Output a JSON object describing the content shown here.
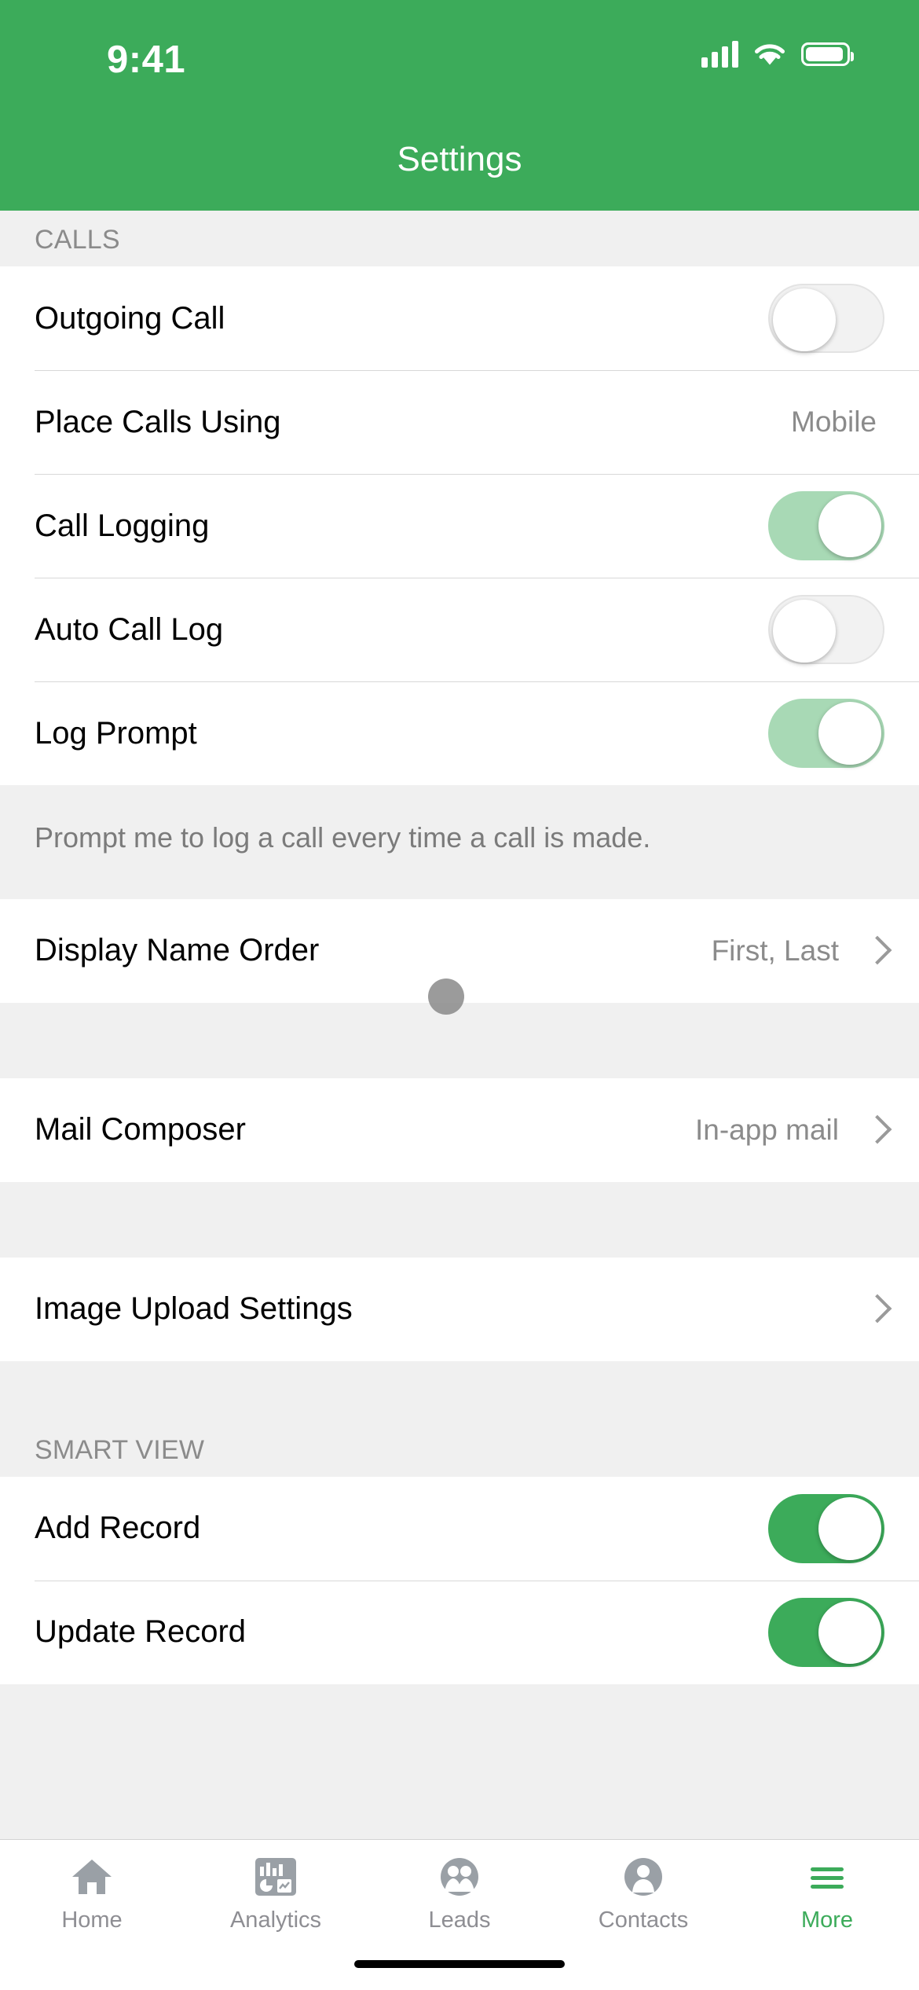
{
  "status_bar": {
    "time": "9:41",
    "icons": [
      "cellular-signal-icon",
      "wifi-icon",
      "battery-icon"
    ]
  },
  "header": {
    "title": "Settings",
    "background_color": "#3cab5a"
  },
  "sections": [
    {
      "header": "CALLS",
      "rows": [
        {
          "label": "Outgoing Call",
          "control": "toggle",
          "state": "off"
        },
        {
          "label": "Place Calls Using",
          "control": "value",
          "value": "Mobile"
        },
        {
          "label": "Call Logging",
          "control": "toggle",
          "state": "dim-on"
        },
        {
          "label": "Auto Call Log",
          "control": "toggle",
          "state": "off"
        },
        {
          "label": "Log Prompt",
          "control": "toggle",
          "state": "dim-on"
        }
      ],
      "footnote": "Prompt me to log a call every time a call is made."
    },
    {
      "header": "",
      "rows": [
        {
          "label": "Display Name Order",
          "control": "disclosure",
          "value": "First, Last"
        }
      ],
      "footnote": ""
    },
    {
      "header": "",
      "rows": [
        {
          "label": "Mail Composer",
          "control": "disclosure",
          "value": "In-app mail"
        }
      ],
      "footnote": ""
    },
    {
      "header": "",
      "rows": [
        {
          "label": "Image Upload Settings",
          "control": "disclosure",
          "value": ""
        }
      ],
      "footnote": ""
    },
    {
      "header": "SMART VIEW",
      "rows": [
        {
          "label": "Add Record",
          "control": "toggle",
          "state": "on"
        },
        {
          "label": "Update Record",
          "control": "toggle",
          "state": "on"
        }
      ],
      "footnote": ""
    }
  ],
  "tab_bar": {
    "items": [
      {
        "label": "Home",
        "icon": "home-icon",
        "active": false
      },
      {
        "label": "Analytics",
        "icon": "analytics-icon",
        "active": false
      },
      {
        "label": "Leads",
        "icon": "leads-icon",
        "active": false
      },
      {
        "label": "Contacts",
        "icon": "contacts-icon",
        "active": false
      },
      {
        "label": "More",
        "icon": "hamburger-icon",
        "active": true
      }
    ],
    "active_color": "#3cab5a",
    "inactive_color": "#8e8e93"
  }
}
